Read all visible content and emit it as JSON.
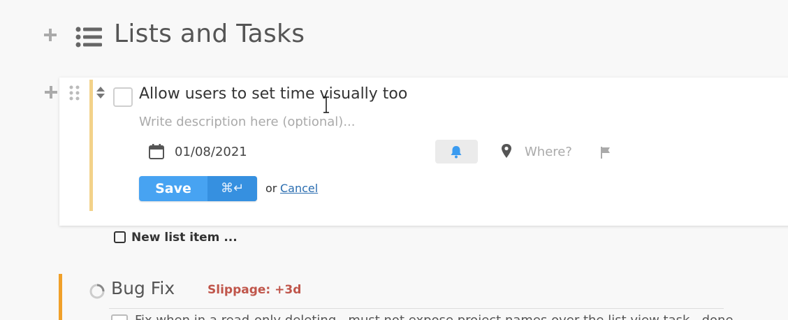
{
  "header": {
    "title": "Lists and Tasks",
    "add_icon": "plus-icon",
    "list_icon": "list-icon"
  },
  "task_editor": {
    "title": "Allow users to set time visually too",
    "description_placeholder": "Write description here (optional)...",
    "date": "01/08/2021",
    "location_placeholder": "Where?",
    "save_label": "Save",
    "save_shortcut": "⌘↵",
    "or_text": "or",
    "cancel_label": "Cancel",
    "accent_color": "#f3d28a",
    "icons": [
      "plus-icon",
      "drag-handle-icon",
      "sort-arrows-icon",
      "calendar-icon",
      "bell-icon",
      "map-pin-icon",
      "flag-icon"
    ]
  },
  "new_item": {
    "label": "New list item ..."
  },
  "bug_fix": {
    "title": "Bug Fix",
    "slippage": "Slippage: +3d",
    "accent_color": "#f0a02a",
    "row_text": "Fix when in a read-only deleting...must not expose project names over the list view task...done"
  },
  "colors": {
    "primary": "#47a3f2",
    "primary_dark": "#3690e0",
    "link": "#2a6db0",
    "slippage": "#c0564b"
  }
}
